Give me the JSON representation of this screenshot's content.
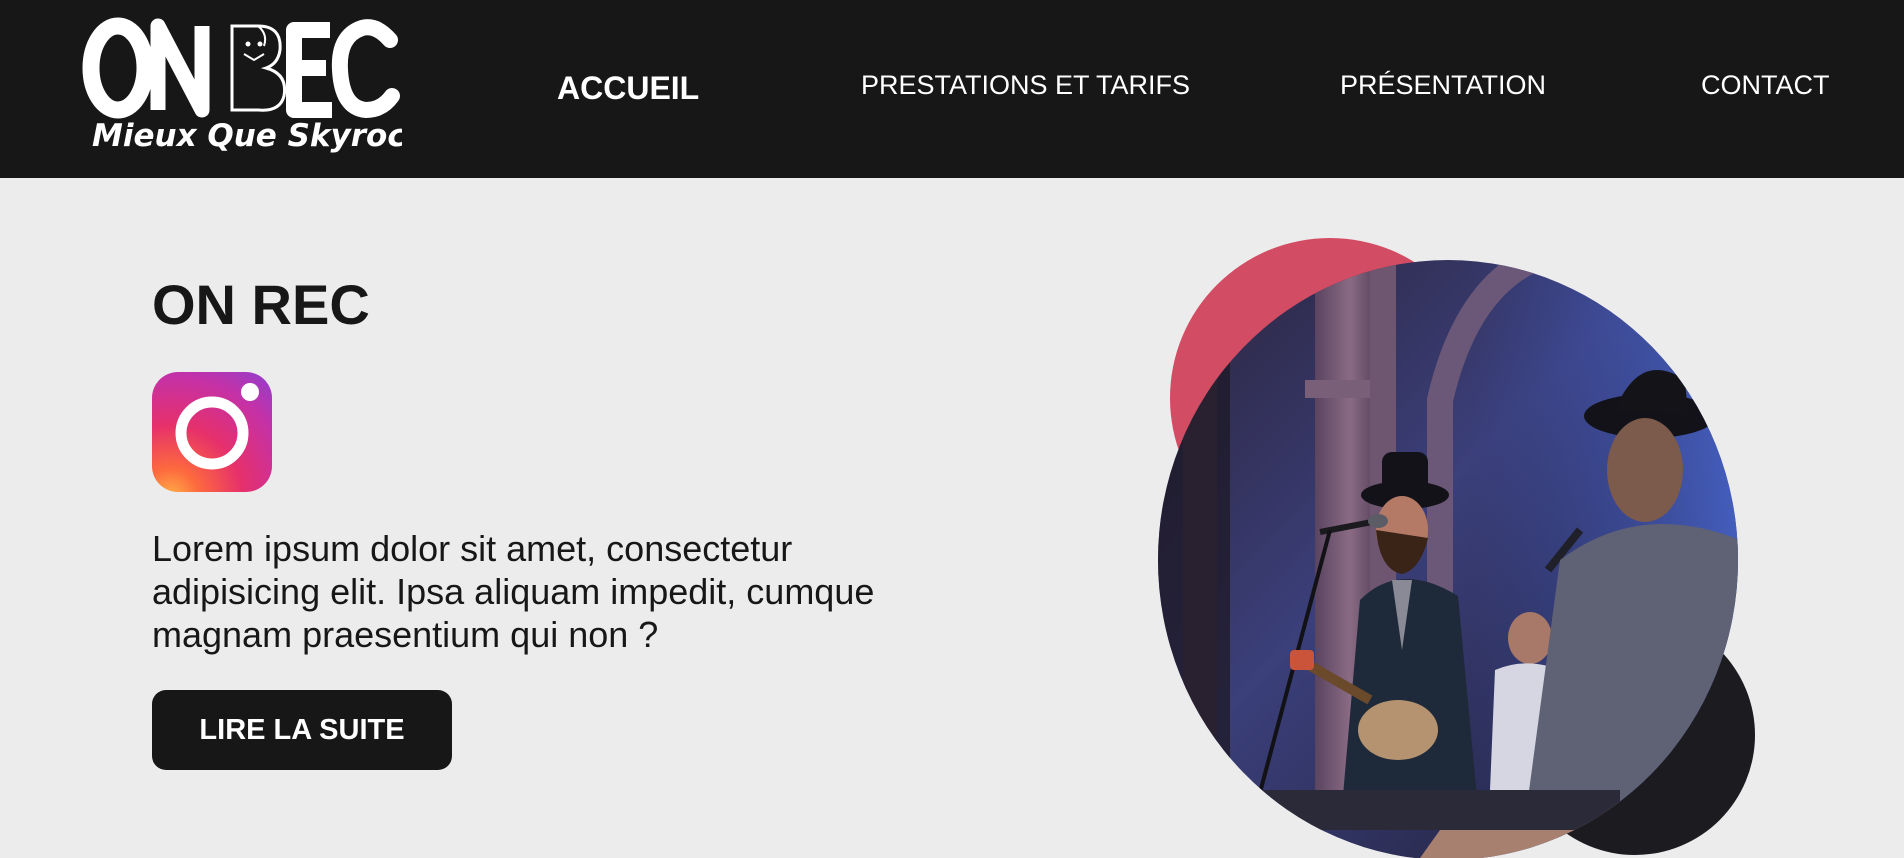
{
  "header": {
    "logo": {
      "brand": "ON REC",
      "tagline": "Mieux Que Skyrock"
    },
    "nav": [
      {
        "label": "ACCUEIL",
        "active": true
      },
      {
        "label": "PRESTATIONS ET TARIFS",
        "active": false
      },
      {
        "label": "PRÉSENTATION",
        "active": false
      },
      {
        "label": "CONTACT",
        "active": false
      }
    ]
  },
  "hero": {
    "title": "ON REC",
    "social_icon": "instagram-icon",
    "text": "Lorem ipsum dolor sit amet, consectetur adipisicing elit. Ipsa aliquam impedit, cumque magnam praesentium qui non ?",
    "button_label": "LIRE LA SUITE"
  },
  "colors": {
    "header_bg": "#171717",
    "page_bg": "#ececec",
    "accent_circle": "#d24c63",
    "button_bg": "#171717",
    "button_text": "#ffffff"
  }
}
